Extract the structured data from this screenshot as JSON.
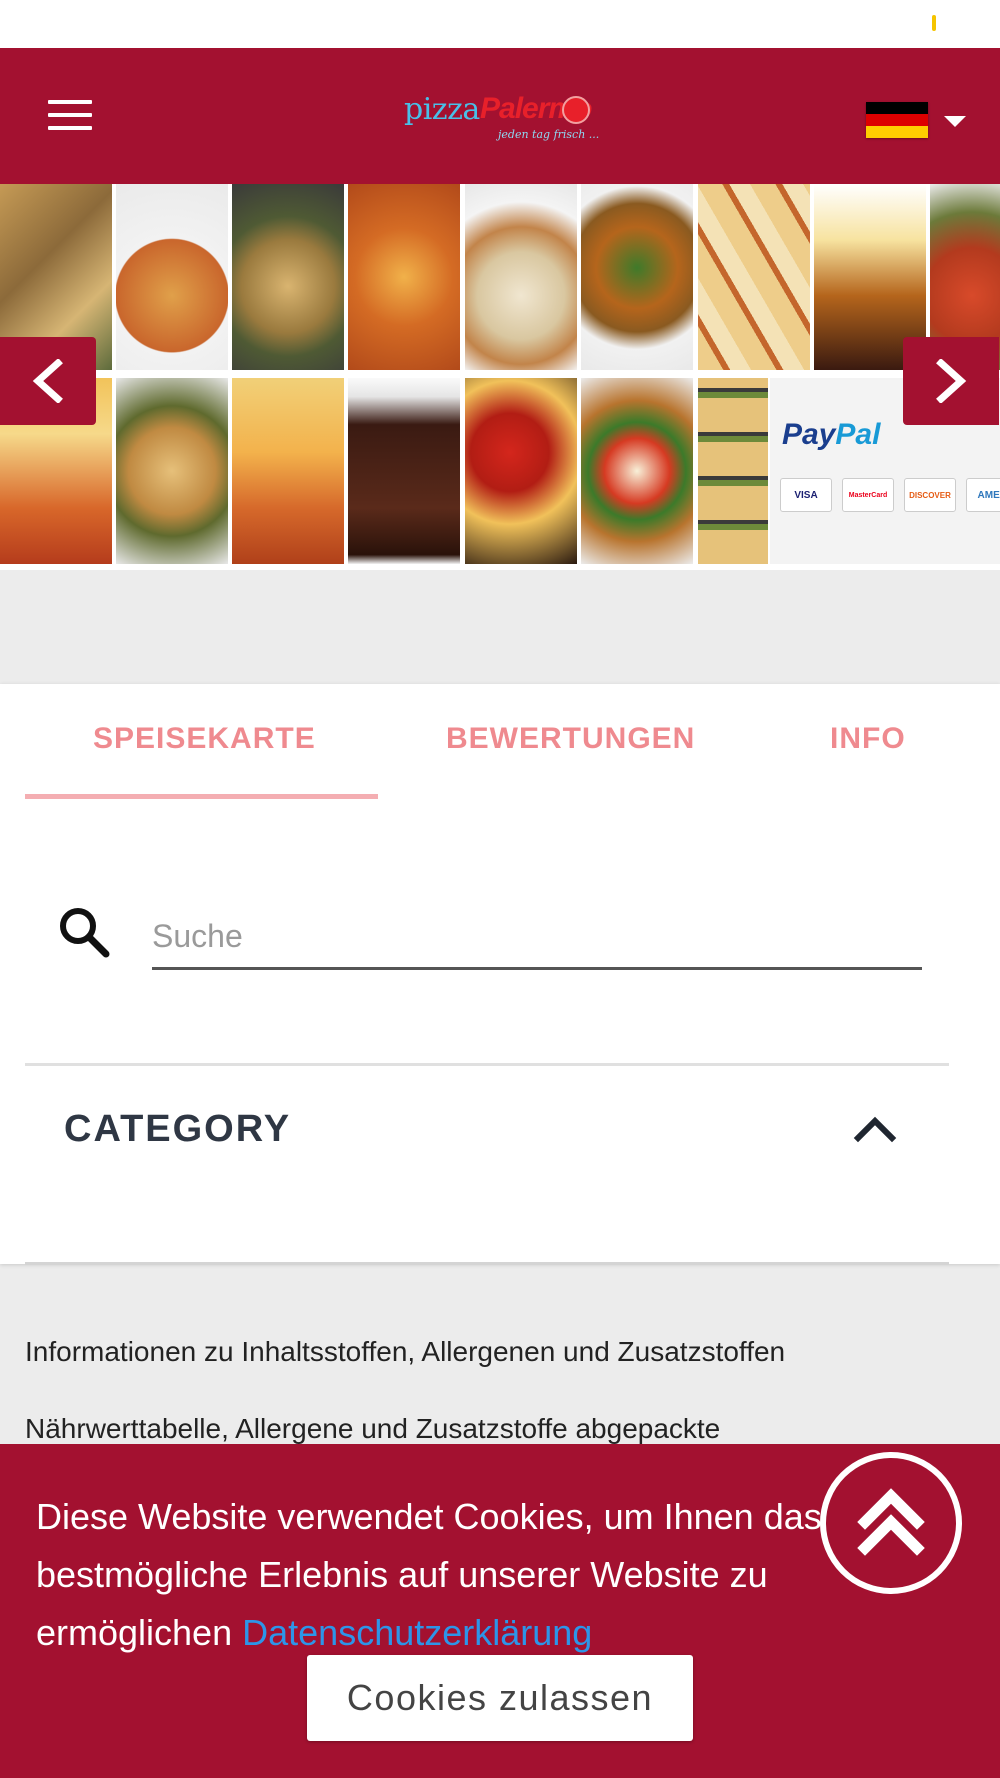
{
  "header": {
    "logo_pizza": "pizza",
    "logo_palermo": "Palermo",
    "logo_tagline": "jeden tag frisch ...",
    "menu_icon": "hamburger-menu-icon",
    "language_icon": "german-flag-icon",
    "colors": {
      "brand": "#a31130"
    }
  },
  "banner": {
    "prev_icon": "chevron-left-icon",
    "next_icon": "chevron-right-icon",
    "paypal_logo_left": "Pay",
    "paypal_logo_right": "Pal",
    "cards": [
      "VISA",
      "MasterCard",
      "DISCOVER",
      "AMEX"
    ]
  },
  "tabs": [
    {
      "label": "SPEISEKARTE",
      "active": true
    },
    {
      "label": "BEWERTUNGEN",
      "active": false
    },
    {
      "label": "INFO",
      "active": false
    }
  ],
  "search": {
    "placeholder": "Suche",
    "value": "",
    "icon": "search-icon"
  },
  "category": {
    "title": "CATEGORY",
    "icon": "chevron-up-icon"
  },
  "info_links": [
    "Informationen zu Inhaltsstoffen, Allergenen und Zusatzstoffen",
    "Nährwerttabelle, Allergene und Zusatzstoffe abgepackte"
  ],
  "cookie": {
    "text": "Diese Website verwendet Cookies, um Ihnen das bestmögliche Erlebnis auf unserer Website zu ermöglichen",
    "link": "Datenschutzerklärung",
    "button": "Cookies zulassen",
    "link_color": "#2d95e8"
  },
  "scroll_top": {
    "icon": "double-chevron-up-icon"
  }
}
